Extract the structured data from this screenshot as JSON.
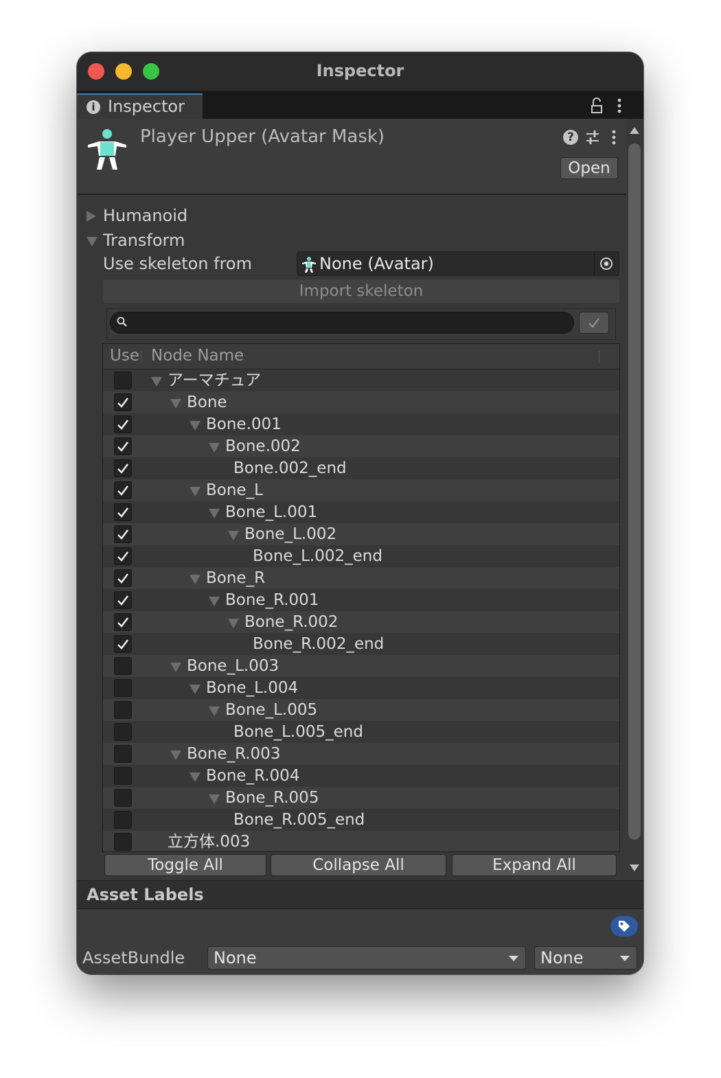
{
  "window": {
    "title": "Inspector"
  },
  "tab": {
    "label": "Inspector"
  },
  "asset": {
    "title": "Player Upper (Avatar Mask)",
    "open_label": "Open"
  },
  "sections": {
    "humanoid": "Humanoid",
    "transform": "Transform"
  },
  "skeleton": {
    "label": "Use skeleton from",
    "value": "None (Avatar)",
    "import_label": "Import skeleton"
  },
  "search": {
    "value": "",
    "placeholder": ""
  },
  "tree": {
    "header_use": "Use",
    "header_name": "Node Name",
    "nodes": [
      {
        "name": "アーマチュア",
        "depth": 0,
        "expanded": true,
        "checked": false
      },
      {
        "name": "Bone",
        "depth": 1,
        "expanded": true,
        "checked": true
      },
      {
        "name": "Bone.001",
        "depth": 2,
        "expanded": true,
        "checked": true
      },
      {
        "name": "Bone.002",
        "depth": 3,
        "expanded": true,
        "checked": true
      },
      {
        "name": "Bone.002_end",
        "depth": 4,
        "expanded": false,
        "checked": true
      },
      {
        "name": "Bone_L",
        "depth": 2,
        "expanded": true,
        "checked": true
      },
      {
        "name": "Bone_L.001",
        "depth": 3,
        "expanded": true,
        "checked": true
      },
      {
        "name": "Bone_L.002",
        "depth": 4,
        "expanded": true,
        "checked": true
      },
      {
        "name": "Bone_L.002_end",
        "depth": 5,
        "expanded": false,
        "checked": true
      },
      {
        "name": "Bone_R",
        "depth": 2,
        "expanded": true,
        "checked": true
      },
      {
        "name": "Bone_R.001",
        "depth": 3,
        "expanded": true,
        "checked": true
      },
      {
        "name": "Bone_R.002",
        "depth": 4,
        "expanded": true,
        "checked": true
      },
      {
        "name": "Bone_R.002_end",
        "depth": 5,
        "expanded": false,
        "checked": true
      },
      {
        "name": "Bone_L.003",
        "depth": 1,
        "expanded": true,
        "checked": false
      },
      {
        "name": "Bone_L.004",
        "depth": 2,
        "expanded": true,
        "checked": false
      },
      {
        "name": "Bone_L.005",
        "depth": 3,
        "expanded": true,
        "checked": false
      },
      {
        "name": "Bone_L.005_end",
        "depth": 4,
        "expanded": false,
        "checked": false
      },
      {
        "name": "Bone_R.003",
        "depth": 1,
        "expanded": true,
        "checked": false
      },
      {
        "name": "Bone_R.004",
        "depth": 2,
        "expanded": true,
        "checked": false
      },
      {
        "name": "Bone_R.005",
        "depth": 3,
        "expanded": true,
        "checked": false
      },
      {
        "name": "Bone_R.005_end",
        "depth": 4,
        "expanded": false,
        "checked": false
      },
      {
        "name": "立方体.003",
        "depth": 0,
        "expanded": false,
        "checked": false
      }
    ],
    "buttons": {
      "toggle_all": "Toggle All",
      "collapse_all": "Collapse All",
      "expand_all": "Expand All"
    }
  },
  "asset_labels": {
    "title": "Asset Labels"
  },
  "asset_bundle": {
    "label": "AssetBundle",
    "name_value": "None",
    "variant_value": "None"
  },
  "colors": {
    "accent_tab": "#3a79bb",
    "avatar_icon": "#6ee0d0",
    "tag_button": "#2d5aa0"
  },
  "icons": [
    "info-icon",
    "lock-icon",
    "kebab-menu-icon",
    "avatar-icon",
    "help-icon",
    "presets-icon",
    "object-picker-icon",
    "search-icon",
    "check-icon",
    "tag-icon",
    "chevron-down-icon"
  ]
}
